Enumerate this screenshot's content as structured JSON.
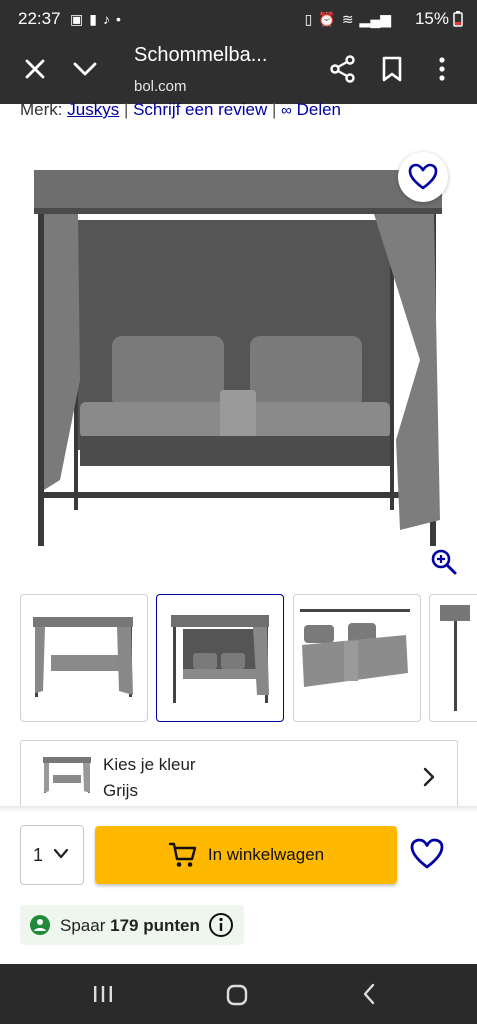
{
  "status": {
    "time": "22:37",
    "battery": "15%"
  },
  "toolbar": {
    "title": "Schommelba...",
    "domain": "bol.com"
  },
  "product": {
    "merk_label": "Merk:",
    "brand": "Juskys",
    "separator1": "|",
    "review_link": "Schrijf een review",
    "separator2": "|",
    "share_link": "Delen"
  },
  "color": {
    "label": "Kies je kleur",
    "value": "Grijs"
  },
  "purchase": {
    "quantity": "1",
    "cart_button": "In winkelwagen"
  },
  "points": {
    "prefix": "Spaar",
    "amount": "179 punten"
  },
  "colors": {
    "accent": "#0000a4",
    "cart": "#ffb800",
    "bar": "#2f2f2f"
  }
}
